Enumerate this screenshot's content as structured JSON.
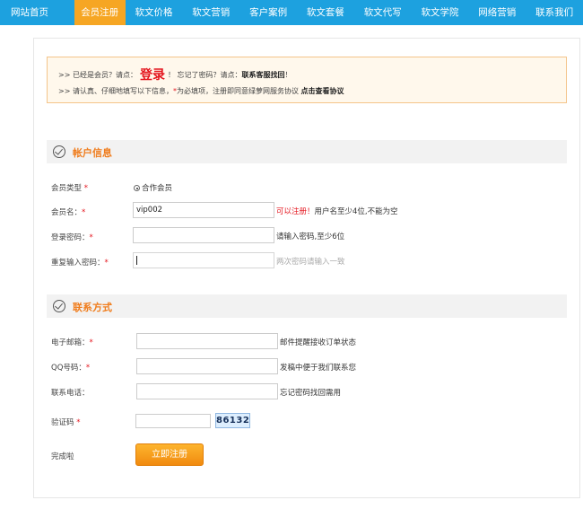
{
  "nav": {
    "items": [
      {
        "label": "网站首页"
      },
      {
        "label": "会员注册"
      },
      {
        "label": "软文价格"
      },
      {
        "label": "软文营销"
      },
      {
        "label": "客户案例"
      },
      {
        "label": "软文套餐"
      },
      {
        "label": "软文代写"
      },
      {
        "label": "软文学院"
      },
      {
        "label": "网络营销"
      },
      {
        "label": "联系我们"
      }
    ],
    "active_index": 1
  },
  "notice": {
    "line1_prefix": ">> 已经是会员？请点：",
    "login_link": "登录",
    "line1_mid": "！  忘记了密码？请点：",
    "recover_link": "联系客服找回",
    "line1_suffix": "！",
    "line2_prefix": ">> 请认真、仔细地填写以下信息，",
    "line2_star": "*",
    "line2_mid": "为必填项，注册即同意绿萝网服务协议 ",
    "agreement_link": "点击查看协议"
  },
  "account_section": {
    "title": "帐户信息",
    "member_type_label": "会员类型",
    "member_type_option": "合作会员",
    "username_label": "会员名：",
    "username_value": "vip002",
    "username_ok": "可以注册！",
    "username_hint": "用户名至少4位,不能为空",
    "password_label": "登录密码：",
    "password_hint": "请输入密码,至少6位",
    "repeat_label": "重复输入密码：",
    "repeat_hint": "两次密码请输入一致"
  },
  "contact_section": {
    "title": "联系方式",
    "email_label": "电子邮箱：",
    "email_hint": "邮件提醒接收订单状态",
    "qq_label": "QQ号码：",
    "qq_hint": "发稿中便于我们联系您",
    "phone_label": "联系电话：",
    "phone_hint": "忘记密码找回需用",
    "captcha_label": "验证码",
    "captcha_code": "86132",
    "finish_label": "完成啦",
    "submit_label": "立即注册"
  },
  "required_mark": "*",
  "colors": {
    "nav_bg": "#1da1df",
    "nav_active": "#f6a623",
    "section_title": "#f07d1d",
    "required": "#e4141d"
  }
}
